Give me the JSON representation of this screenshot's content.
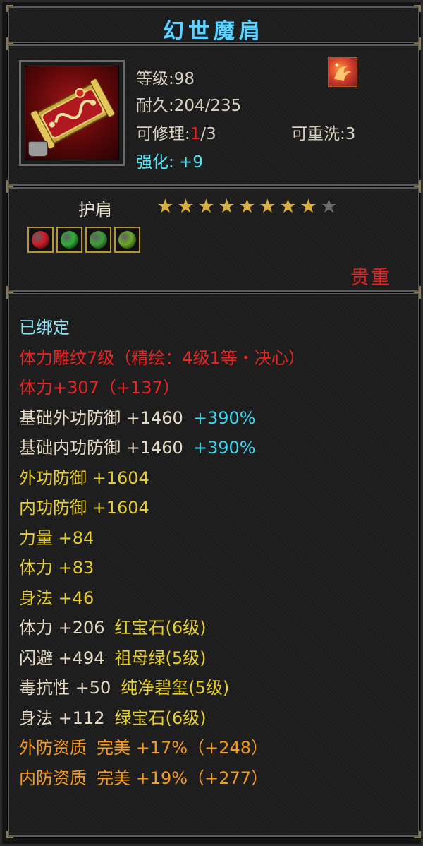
{
  "item": {
    "name": "幻世魔肩",
    "level_line": "等级:98",
    "durability_line": "耐久:204/235",
    "repair_prefix": "可修理:",
    "repair_used": "1",
    "repair_total": "/3",
    "wash_line": "可重洗:3",
    "enhance_line": "强化: +9",
    "type": "护肩",
    "rarity": "贵重",
    "stars_filled": 8,
    "stars_total": 9
  },
  "gems": [
    {
      "name": "red-gem",
      "color": "#d21a2a"
    },
    {
      "name": "green-gem",
      "color": "#2fae3a"
    },
    {
      "name": "green-gem",
      "color": "#3fa03a"
    },
    {
      "name": "yellow-green-gem",
      "color": "#6aa82a"
    }
  ],
  "attributes": [
    {
      "parts": [
        {
          "text": "已绑定",
          "tone": "cyan"
        }
      ]
    },
    {
      "parts": [
        {
          "text": "体力雕纹7级（精绘：4级1等・决心）",
          "tone": "red"
        }
      ]
    },
    {
      "parts": [
        {
          "text": "体力+307（+137）",
          "tone": "red"
        }
      ]
    },
    {
      "parts": [
        {
          "text": "基础外功防御 +1460",
          "tone": "base"
        },
        {
          "text": "+390%",
          "tone": "teal"
        }
      ]
    },
    {
      "parts": [
        {
          "text": "基础内功防御 +1460",
          "tone": "base"
        },
        {
          "text": "+390%",
          "tone": "teal"
        }
      ]
    },
    {
      "parts": [
        {
          "text": "外功防御 +1604",
          "tone": "yellow"
        }
      ]
    },
    {
      "parts": [
        {
          "text": "内功防御 +1604",
          "tone": "yellow"
        }
      ]
    },
    {
      "parts": [
        {
          "text": "力量 +84",
          "tone": "yellow"
        }
      ]
    },
    {
      "parts": [
        {
          "text": "体力 +83",
          "tone": "yellow"
        }
      ]
    },
    {
      "parts": [
        {
          "text": "身法 +46",
          "tone": "yellow"
        }
      ]
    },
    {
      "parts": [
        {
          "text": "体力 +206",
          "tone": "base"
        },
        {
          "text": "红宝石(6级)",
          "tone": "yellow"
        }
      ]
    },
    {
      "parts": [
        {
          "text": "闪避 +494",
          "tone": "base"
        },
        {
          "text": "祖母绿(5级)",
          "tone": "yellow"
        }
      ]
    },
    {
      "parts": [
        {
          "text": "毒抗性 +50",
          "tone": "base"
        },
        {
          "text": "纯净碧玺(5级)",
          "tone": "yellow"
        }
      ]
    },
    {
      "parts": [
        {
          "text": "身法 +112",
          "tone": "base"
        },
        {
          "text": "绿宝石(6级)",
          "tone": "yellow"
        }
      ]
    },
    {
      "parts": [
        {
          "text": "外防资质",
          "tone": "orange"
        },
        {
          "text": "完美 +17%（+248）",
          "tone": "orange"
        }
      ]
    },
    {
      "parts": [
        {
          "text": "内防资质",
          "tone": "orange"
        },
        {
          "text": "完美 +19%（+277）",
          "tone": "orange"
        }
      ]
    }
  ]
}
